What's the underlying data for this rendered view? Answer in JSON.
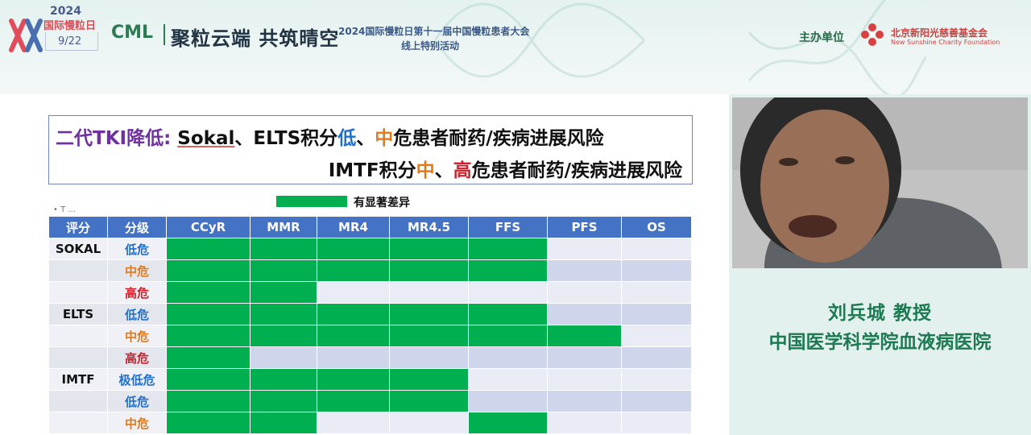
{
  "banner": {
    "year": "2024",
    "day_name": "国际慢粒日",
    "date": "9/22",
    "cml": "CML",
    "slogan": "聚粒云端 共筑晴空",
    "conference_title": "2024国际慢粒日第十一届中国慢粒患者大会",
    "conference_subtitle": "线上特别活动",
    "host_label": "主办单位",
    "host_org": "北京新阳光慈善基金会",
    "host_org_en": "New Sunshine Charity Foundation"
  },
  "slide": {
    "title_line1": {
      "part1": "二代TKI降低: ",
      "part2": "Sokal",
      "part3": "、ELTS积分",
      "low": "低",
      "sep": "、",
      "mid": "中",
      "part4": "危患者耐药/疾病进展风险"
    },
    "title_line2": {
      "part1": "IMTF积分",
      "mid": "中",
      "sep": "、",
      "high": "高",
      "part2": "危患者耐药/疾病进展风险"
    },
    "legend_label": "有显著差异",
    "ghost_text": "• T ...",
    "table": {
      "headers": [
        "评分",
        "分级",
        "CCyR",
        "MMR",
        "MR4",
        "MR4.5",
        "FFS",
        "PFS",
        "OS"
      ],
      "rows": [
        {
          "score": "SOKAL",
          "level": "低危",
          "level_color": "#1f6ed0",
          "sig": [
            1,
            1,
            1,
            1,
            1,
            0,
            0
          ]
        },
        {
          "score": "",
          "level": "中危",
          "level_color": "#e07a1a",
          "sig": [
            1,
            1,
            1,
            1,
            1,
            0,
            0
          ]
        },
        {
          "score": "",
          "level": "高危",
          "level_color": "#d0202a",
          "sig": [
            1,
            1,
            0,
            0,
            0,
            0,
            0
          ]
        },
        {
          "score": "ELTS",
          "level": "低危",
          "level_color": "#1f6ed0",
          "sig": [
            1,
            1,
            1,
            1,
            1,
            0,
            0
          ]
        },
        {
          "score": "",
          "level": "中危",
          "level_color": "#e07a1a",
          "sig": [
            1,
            1,
            1,
            1,
            1,
            1,
            0
          ]
        },
        {
          "score": "",
          "level": "高危",
          "level_color": "#d0202a",
          "sig": [
            1,
            0,
            0,
            0,
            0,
            0,
            0
          ]
        },
        {
          "score": "IMTF",
          "level": "极低危",
          "level_color": "#1f6ed0",
          "sig": [
            1,
            1,
            1,
            1,
            0,
            0,
            0
          ]
        },
        {
          "score": "",
          "level": "低危",
          "level_color": "#1f6ed0",
          "sig": [
            1,
            1,
            1,
            1,
            0,
            0,
            0
          ]
        },
        {
          "score": "",
          "level": "中危",
          "level_color": "#e07a1a",
          "sig": [
            1,
            1,
            0,
            0,
            1,
            0,
            0
          ]
        }
      ]
    }
  },
  "speaker": {
    "name": "刘兵城 教授",
    "institution": "中国医学科学院血液病医院"
  },
  "colors": {
    "significant": "#00b050",
    "header": "#4472c4",
    "not_significant": "#cfd5ea",
    "speaker_text": "#1d7a52"
  }
}
